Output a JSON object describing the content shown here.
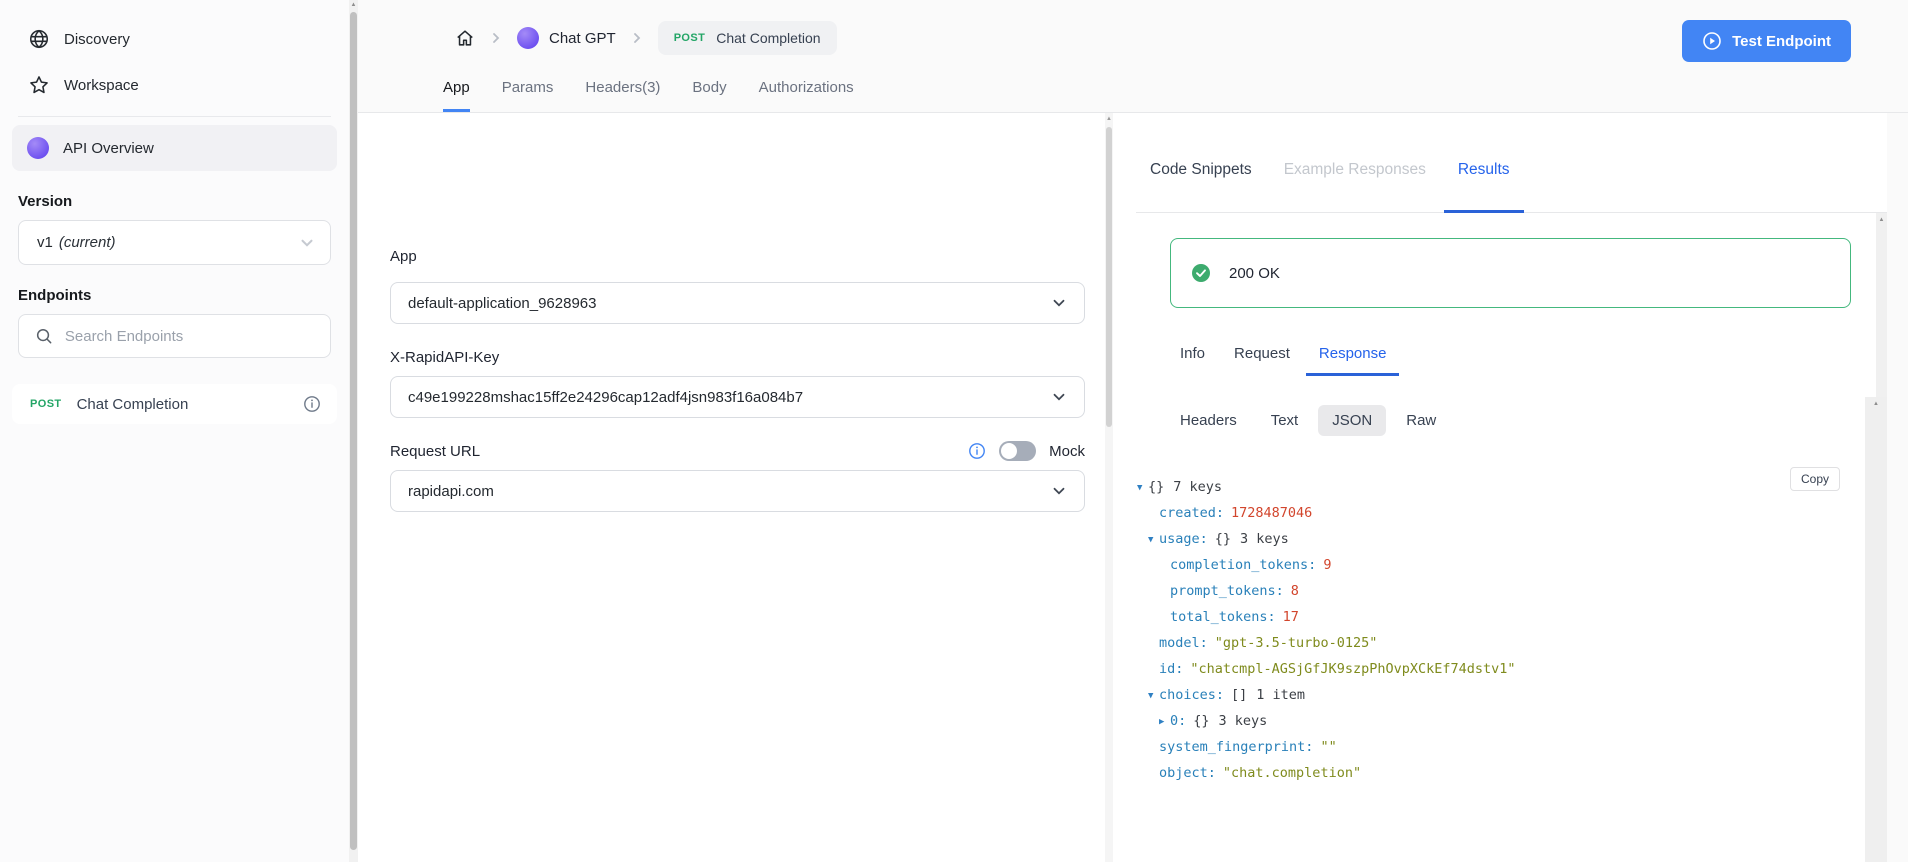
{
  "sidebar": {
    "items": [
      {
        "label": "Discovery",
        "icon": "globe-icon"
      },
      {
        "label": "Workspace",
        "icon": "star-icon"
      }
    ],
    "api_overview_label": "API Overview",
    "version_label": "Version",
    "version_value": "v1",
    "version_note": "(current)",
    "endpoints_label": "Endpoints",
    "search_placeholder": "Search Endpoints",
    "endpoint": {
      "method": "POST",
      "name": "Chat Completion"
    }
  },
  "header": {
    "breadcrumb": {
      "api_name": "Chat GPT",
      "method": "POST",
      "endpoint": "Chat Completion"
    },
    "test_endpoint_label": "Test Endpoint",
    "tabs": [
      "App",
      "Params",
      "Headers(3)",
      "Body",
      "Authorizations"
    ],
    "active_tab": "App"
  },
  "form": {
    "app_label": "App",
    "app_value": "default-application_9628963",
    "key_label": "X-RapidAPI-Key",
    "key_value": "c49e199228mshac15ff2e24296cap12adf4jsn983f16a084b7",
    "url_label": "Request URL",
    "url_value": "rapidapi.com",
    "mock_label": "Mock",
    "mock_enabled": false
  },
  "results": {
    "tabs": [
      "Code Snippets",
      "Example Responses",
      "Results"
    ],
    "active_tab": "Results",
    "status_text": "200 OK",
    "detail_tabs": [
      "Info",
      "Request",
      "Response"
    ],
    "active_detail_tab": "Response",
    "format_tabs": [
      "Headers",
      "Text",
      "JSON",
      "Raw"
    ],
    "active_format": "JSON",
    "copy_label": "Copy",
    "json_tree": {
      "lines": [
        {
          "indent": 0,
          "arrow": "down",
          "badge": "{}",
          "count": "7 keys"
        },
        {
          "indent": 1,
          "key": "created",
          "value": "1728487046",
          "value_type": "number"
        },
        {
          "indent": 1,
          "arrow": "down",
          "key": "usage",
          "badge": "{}",
          "count": "3 keys"
        },
        {
          "indent": 2,
          "key": "completion_tokens",
          "value": "9",
          "value_type": "number"
        },
        {
          "indent": 2,
          "key": "prompt_tokens",
          "value": "8",
          "value_type": "number"
        },
        {
          "indent": 2,
          "key": "total_tokens",
          "value": "17",
          "value_type": "number"
        },
        {
          "indent": 1,
          "key": "model",
          "value": "\"gpt-3.5-turbo-0125\"",
          "value_type": "string"
        },
        {
          "indent": 1,
          "key": "id",
          "value": "\"chatcmpl-AGSjGfJK9szpPhOvpXCkEf74dstv1\"",
          "value_type": "string"
        },
        {
          "indent": 1,
          "arrow": "down",
          "key": "choices",
          "badge": "[]",
          "count": "1 item"
        },
        {
          "indent": 2,
          "arrow": "right",
          "key": "0",
          "badge": "{}",
          "count": "3 keys"
        },
        {
          "indent": 1,
          "key": "system_fingerprint",
          "value": "\"\"",
          "value_type": "string"
        },
        {
          "indent": 1,
          "key": "object",
          "value": "\"chat.completion\"",
          "value_type": "string"
        }
      ]
    }
  },
  "colors": {
    "accent_blue": "#4285f4",
    "tab_active_blue": "#2563eb",
    "method_green": "#23a566",
    "status_green": "#44b87e",
    "json_key": "#2980b9",
    "json_number": "#d2452c",
    "json_string": "#7f8b1d"
  }
}
